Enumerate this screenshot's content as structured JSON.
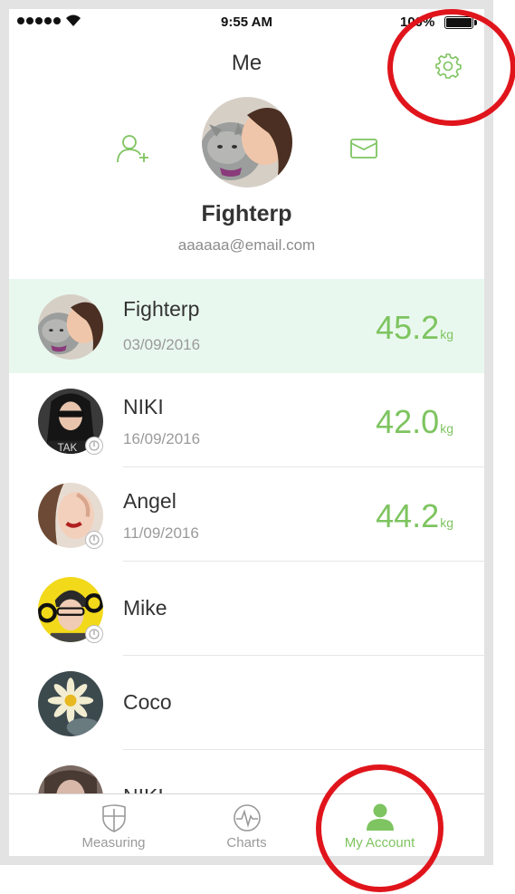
{
  "status_bar": {
    "time": "9:55 AM",
    "battery": "100%"
  },
  "header": {
    "title": "Me"
  },
  "profile": {
    "name": "Fighterp",
    "email": "aaaaaa@email.com"
  },
  "accent_color": "#7ec460",
  "highlight_color": "#e0151c",
  "users": [
    {
      "name": "Fighterp",
      "date": "03/09/2016",
      "weight": "45.2",
      "unit": "kg",
      "selected": true
    },
    {
      "name": "NIKI",
      "date": "16/09/2016",
      "weight": "42.0",
      "unit": "kg"
    },
    {
      "name": "Angel",
      "date": "11/09/2016",
      "weight": "44.2",
      "unit": "kg"
    },
    {
      "name": "Mike"
    },
    {
      "name": "Coco"
    },
    {
      "name": "NIKI"
    }
  ],
  "tabs": [
    {
      "label": "Measuring",
      "icon": "shield-scale-icon"
    },
    {
      "label": "Charts",
      "icon": "pulse-chart-icon"
    },
    {
      "label": "My Account",
      "icon": "person-icon",
      "active": true
    }
  ]
}
